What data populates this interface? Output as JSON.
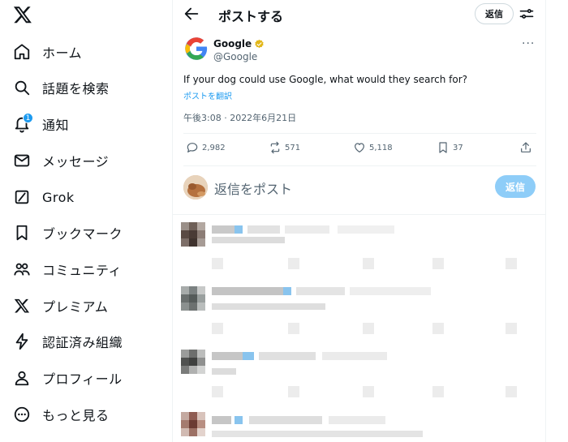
{
  "nav": {
    "items": [
      {
        "label": "ホーム",
        "icon": "home-icon"
      },
      {
        "label": "話題を検索",
        "icon": "search-icon"
      },
      {
        "label": "通知",
        "icon": "bell-icon",
        "badge": "1"
      },
      {
        "label": "メッセージ",
        "icon": "envelope-icon"
      },
      {
        "label": "Grok",
        "icon": "grok-icon"
      },
      {
        "label": "ブックマーク",
        "icon": "bookmark-icon"
      },
      {
        "label": "コミュニティ",
        "icon": "community-icon"
      },
      {
        "label": "プレミアム",
        "icon": "x-premium-icon"
      },
      {
        "label": "認証済み組織",
        "icon": "lightning-icon"
      },
      {
        "label": "プロフィール",
        "icon": "person-icon"
      },
      {
        "label": "もっと見る",
        "icon": "more-circle-icon"
      }
    ]
  },
  "header": {
    "title": "ポストする",
    "reply_button": "返信"
  },
  "tweet": {
    "author_name": "Google",
    "author_handle": "@Google",
    "text": "If your dog could use Google, what would they search for?",
    "translate_link": "ポストを翻訳",
    "timestamp": "午後3:08 · 2022年6月21日",
    "stats": {
      "replies": "2,982",
      "reposts": "571",
      "likes": "5,118",
      "bookmarks": "37"
    }
  },
  "composer": {
    "placeholder": "返信をポスト",
    "reply_button": "返信"
  },
  "colors": {
    "accent": "#1d9bf0",
    "reply_disabled": "#8ecdf8",
    "text_secondary": "#536471",
    "verified_gold": "#e2b719"
  }
}
